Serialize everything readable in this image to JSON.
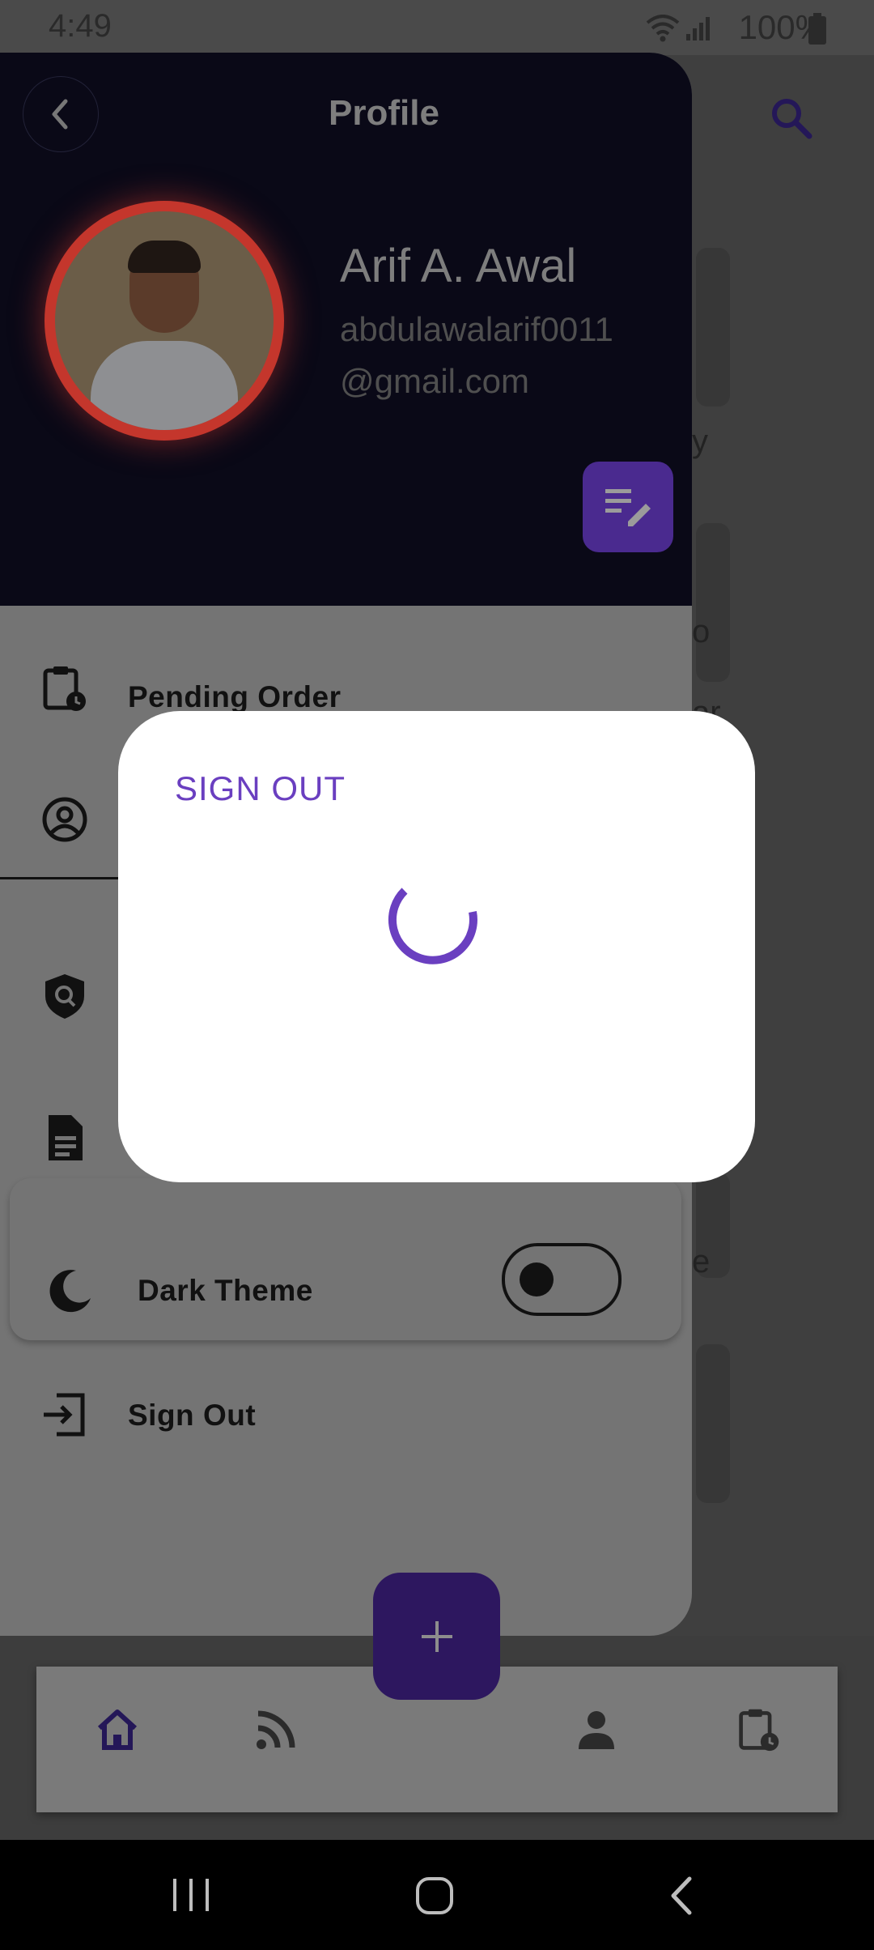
{
  "status_bar": {
    "time": "4:49",
    "battery": "100%"
  },
  "profile": {
    "title": "Profile",
    "name": "Arif A. Awal",
    "email_line1": "abdulawalarif0011",
    "email_line2": "@gmail.com"
  },
  "menu": {
    "pending_order": "Pending Order",
    "dark_theme": "Dark Theme",
    "sign_out": "Sign Out",
    "dark_theme_on": false
  },
  "dialog": {
    "title": "SIGN OUT"
  },
  "background_fragments": {
    "frag1": "y",
    "frag2": "o",
    "frag3": "ar",
    "frag4": "e"
  },
  "colors": {
    "accent": "#6a3fc0",
    "fab": "#2d175f",
    "edit_button": "#4a2a8f",
    "avatar_ring": "#c4362c"
  }
}
